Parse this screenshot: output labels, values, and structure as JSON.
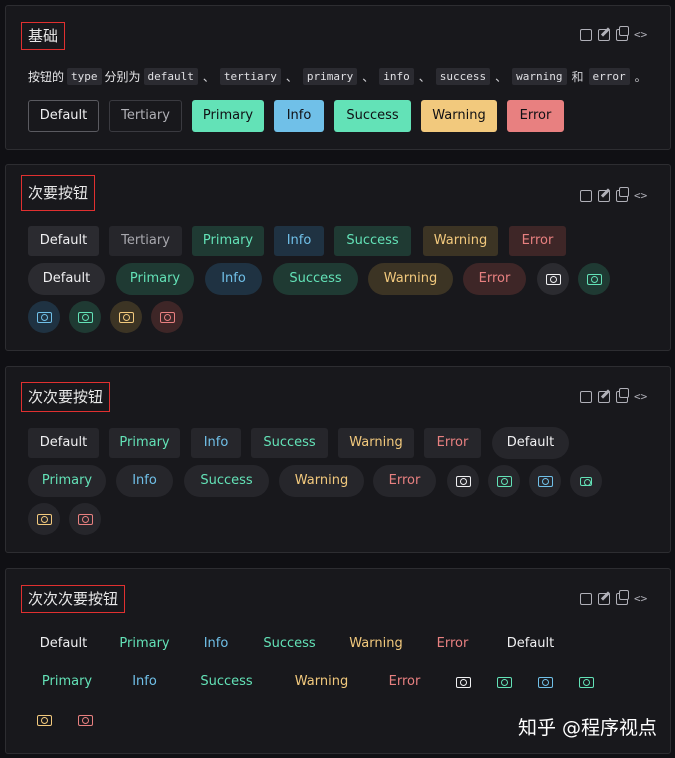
{
  "sections": [
    {
      "title": "基础"
    },
    {
      "title": "次要按钮"
    },
    {
      "title": "次次要按钮"
    },
    {
      "title": "次次次要按钮"
    }
  ],
  "desc": {
    "prefix": "按钮的",
    "type_code": "type",
    "middle": "分别为",
    "types": [
      "default",
      "tertiary",
      "primary",
      "info",
      "success",
      "warning",
      "error"
    ],
    "separator": "、",
    "and": "和",
    "end": "。"
  },
  "labels": {
    "default": "Default",
    "tertiary": "Tertiary",
    "primary": "Primary",
    "info": "Info",
    "success": "Success",
    "warning": "Warning",
    "error": "Error"
  },
  "icons": {
    "tools": [
      "cube-icon",
      "edit-icon",
      "copy-icon",
      "code-icon"
    ],
    "button_icon": "cash-icon"
  },
  "colors": {
    "primary": "#63e2b7",
    "info": "#70c0e8",
    "success": "#63e2b7",
    "warning": "#f2c97d",
    "error": "#e88080",
    "title_border": "#e03030"
  },
  "watermark": "知乎 @程序视点"
}
